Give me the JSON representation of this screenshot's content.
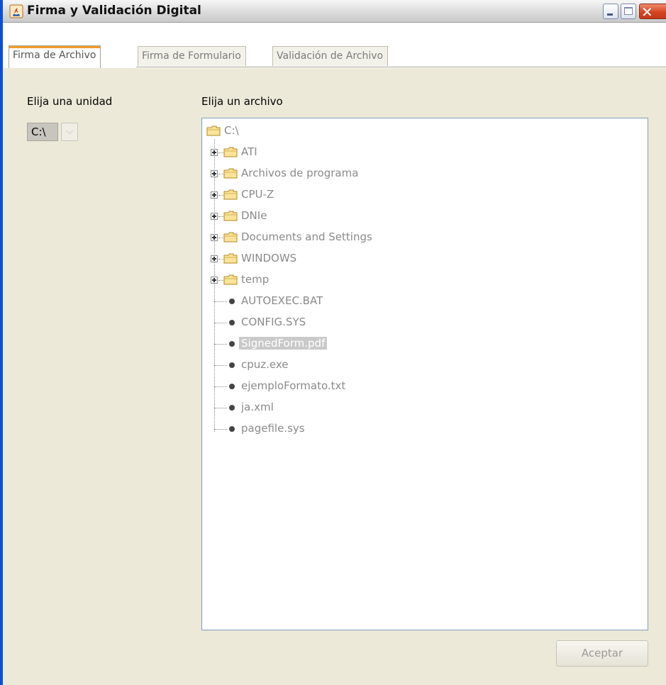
{
  "window": {
    "title": "Firma y Validación Digital"
  },
  "tabs": [
    {
      "label": "Firma de Archivo",
      "active": true
    },
    {
      "label": "Firma de Formulario",
      "active": false
    },
    {
      "label": "Validación de Archivo",
      "active": false
    }
  ],
  "drive": {
    "label": "Elija una unidad",
    "selected": "C:\\",
    "dropdown_icon": "chevron-down-icon"
  },
  "file_tree": {
    "label": "Elija un archivo",
    "root": "C:\\",
    "folders": [
      "ATI",
      "Archivos de programa",
      "CPU-Z",
      "DNIe",
      "Documents and Settings",
      "WINDOWS",
      "temp"
    ],
    "files": [
      "AUTOEXEC.BAT",
      "CONFIG.SYS",
      "SignedForm.pdf",
      "cpuz.exe",
      "ejemploFormato.txt",
      "ja.xml",
      "pagefile.sys"
    ],
    "selected_file": "SignedForm.pdf"
  },
  "accept_button": {
    "label": "Aceptar",
    "enabled": false
  },
  "colors": {
    "tab_active_accent": "#f39c2c",
    "close_button": "#d6451f",
    "tree_text": "#8a8a8a"
  }
}
